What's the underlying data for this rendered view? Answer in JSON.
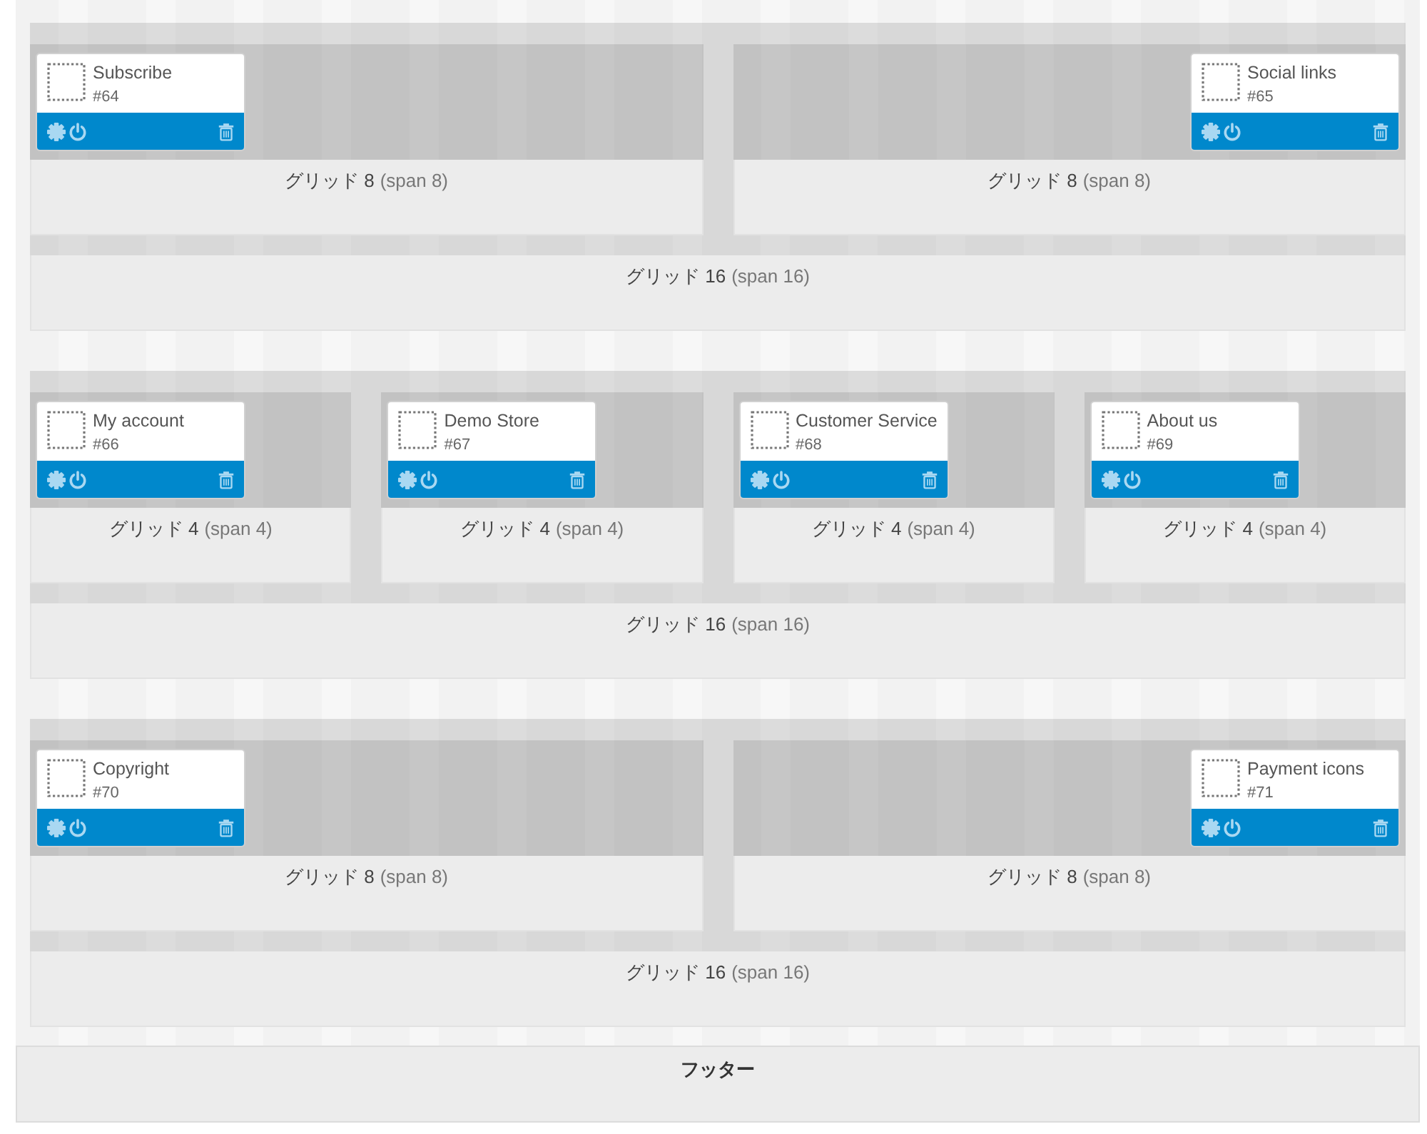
{
  "sections": [
    {
      "columns": [
        {
          "label": "グリッド 8",
          "span": "(span 8)",
          "right_aligned": false,
          "modules": [
            {
              "title": "Subscribe",
              "number": "#64"
            }
          ]
        },
        {
          "label": "グリッド 8",
          "span": "(span 8)",
          "right_aligned": true,
          "modules": [
            {
              "title": "Social links",
              "number": "#65"
            }
          ]
        }
      ],
      "label": "グリッド 16",
      "span": "(span 16)"
    },
    {
      "columns": [
        {
          "label": "グリッド 4",
          "span": "(span 4)",
          "right_aligned": false,
          "modules": [
            {
              "title": "My account",
              "number": "#66"
            }
          ]
        },
        {
          "label": "グリッド 4",
          "span": "(span 4)",
          "right_aligned": false,
          "modules": [
            {
              "title": "Demo Store",
              "number": "#67"
            }
          ]
        },
        {
          "label": "グリッド 4",
          "span": "(span 4)",
          "right_aligned": false,
          "modules": [
            {
              "title": "Customer Service",
              "number": "#68"
            }
          ]
        },
        {
          "label": "グリッド 4",
          "span": "(span 4)",
          "right_aligned": false,
          "modules": [
            {
              "title": "About us",
              "number": "#69"
            }
          ]
        }
      ],
      "label": "グリッド 16",
      "span": "(span 16)"
    },
    {
      "columns": [
        {
          "label": "グリッド 8",
          "span": "(span 8)",
          "right_aligned": false,
          "modules": [
            {
              "title": "Copyright",
              "number": "#70"
            }
          ]
        },
        {
          "label": "グリッド 8",
          "span": "(span 8)",
          "right_aligned": true,
          "modules": [
            {
              "title": "Payment icons",
              "number": "#71"
            }
          ]
        }
      ],
      "label": "グリッド 16",
      "span": "(span 16)"
    }
  ],
  "footer": {
    "label": "フッター"
  }
}
